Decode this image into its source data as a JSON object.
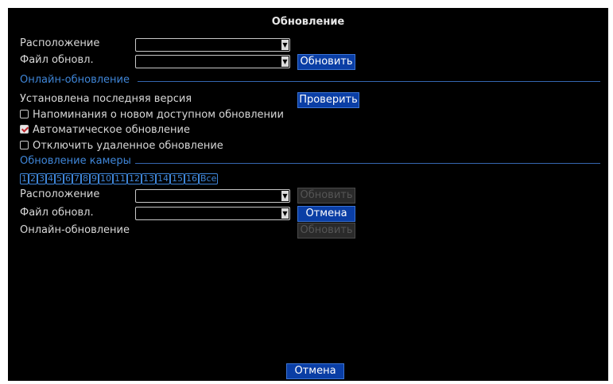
{
  "title": "Обновление",
  "location_label": "Расположение",
  "update_file_label": "Файл обновл.",
  "update_button": "Обновить",
  "online_section_title": "Онлайн-обновление",
  "latest_version_text": "Установлена последняя версия",
  "check_button": "Проверить",
  "checkboxes": [
    {
      "label": "Напоминания о новом доступном обновлении",
      "checked": false
    },
    {
      "label": "Автоматическое обновление",
      "checked": true
    },
    {
      "label": "Отключить удаленное обновление",
      "checked": false
    }
  ],
  "camera_section_title": "Обновление камеры",
  "channels": [
    "1",
    "2",
    "3",
    "4",
    "5",
    "6",
    "7",
    "8",
    "9",
    "10",
    "11",
    "12",
    "13",
    "14",
    "15",
    "16",
    "Все"
  ],
  "camera_location_label": "Расположение",
  "camera_update_file_label": "Файл обновл.",
  "camera_online_label": "Онлайн-обновление",
  "camera_update_button": "Обновить",
  "camera_cancel_button": "Отмена",
  "camera_online_update_button": "Обновить",
  "bottom_cancel_button": "Отмена",
  "colors": {
    "background": "#000000",
    "accent": "#3f86d8",
    "button": "#0a3ea5",
    "disabled_button": "#2a2a2a"
  }
}
